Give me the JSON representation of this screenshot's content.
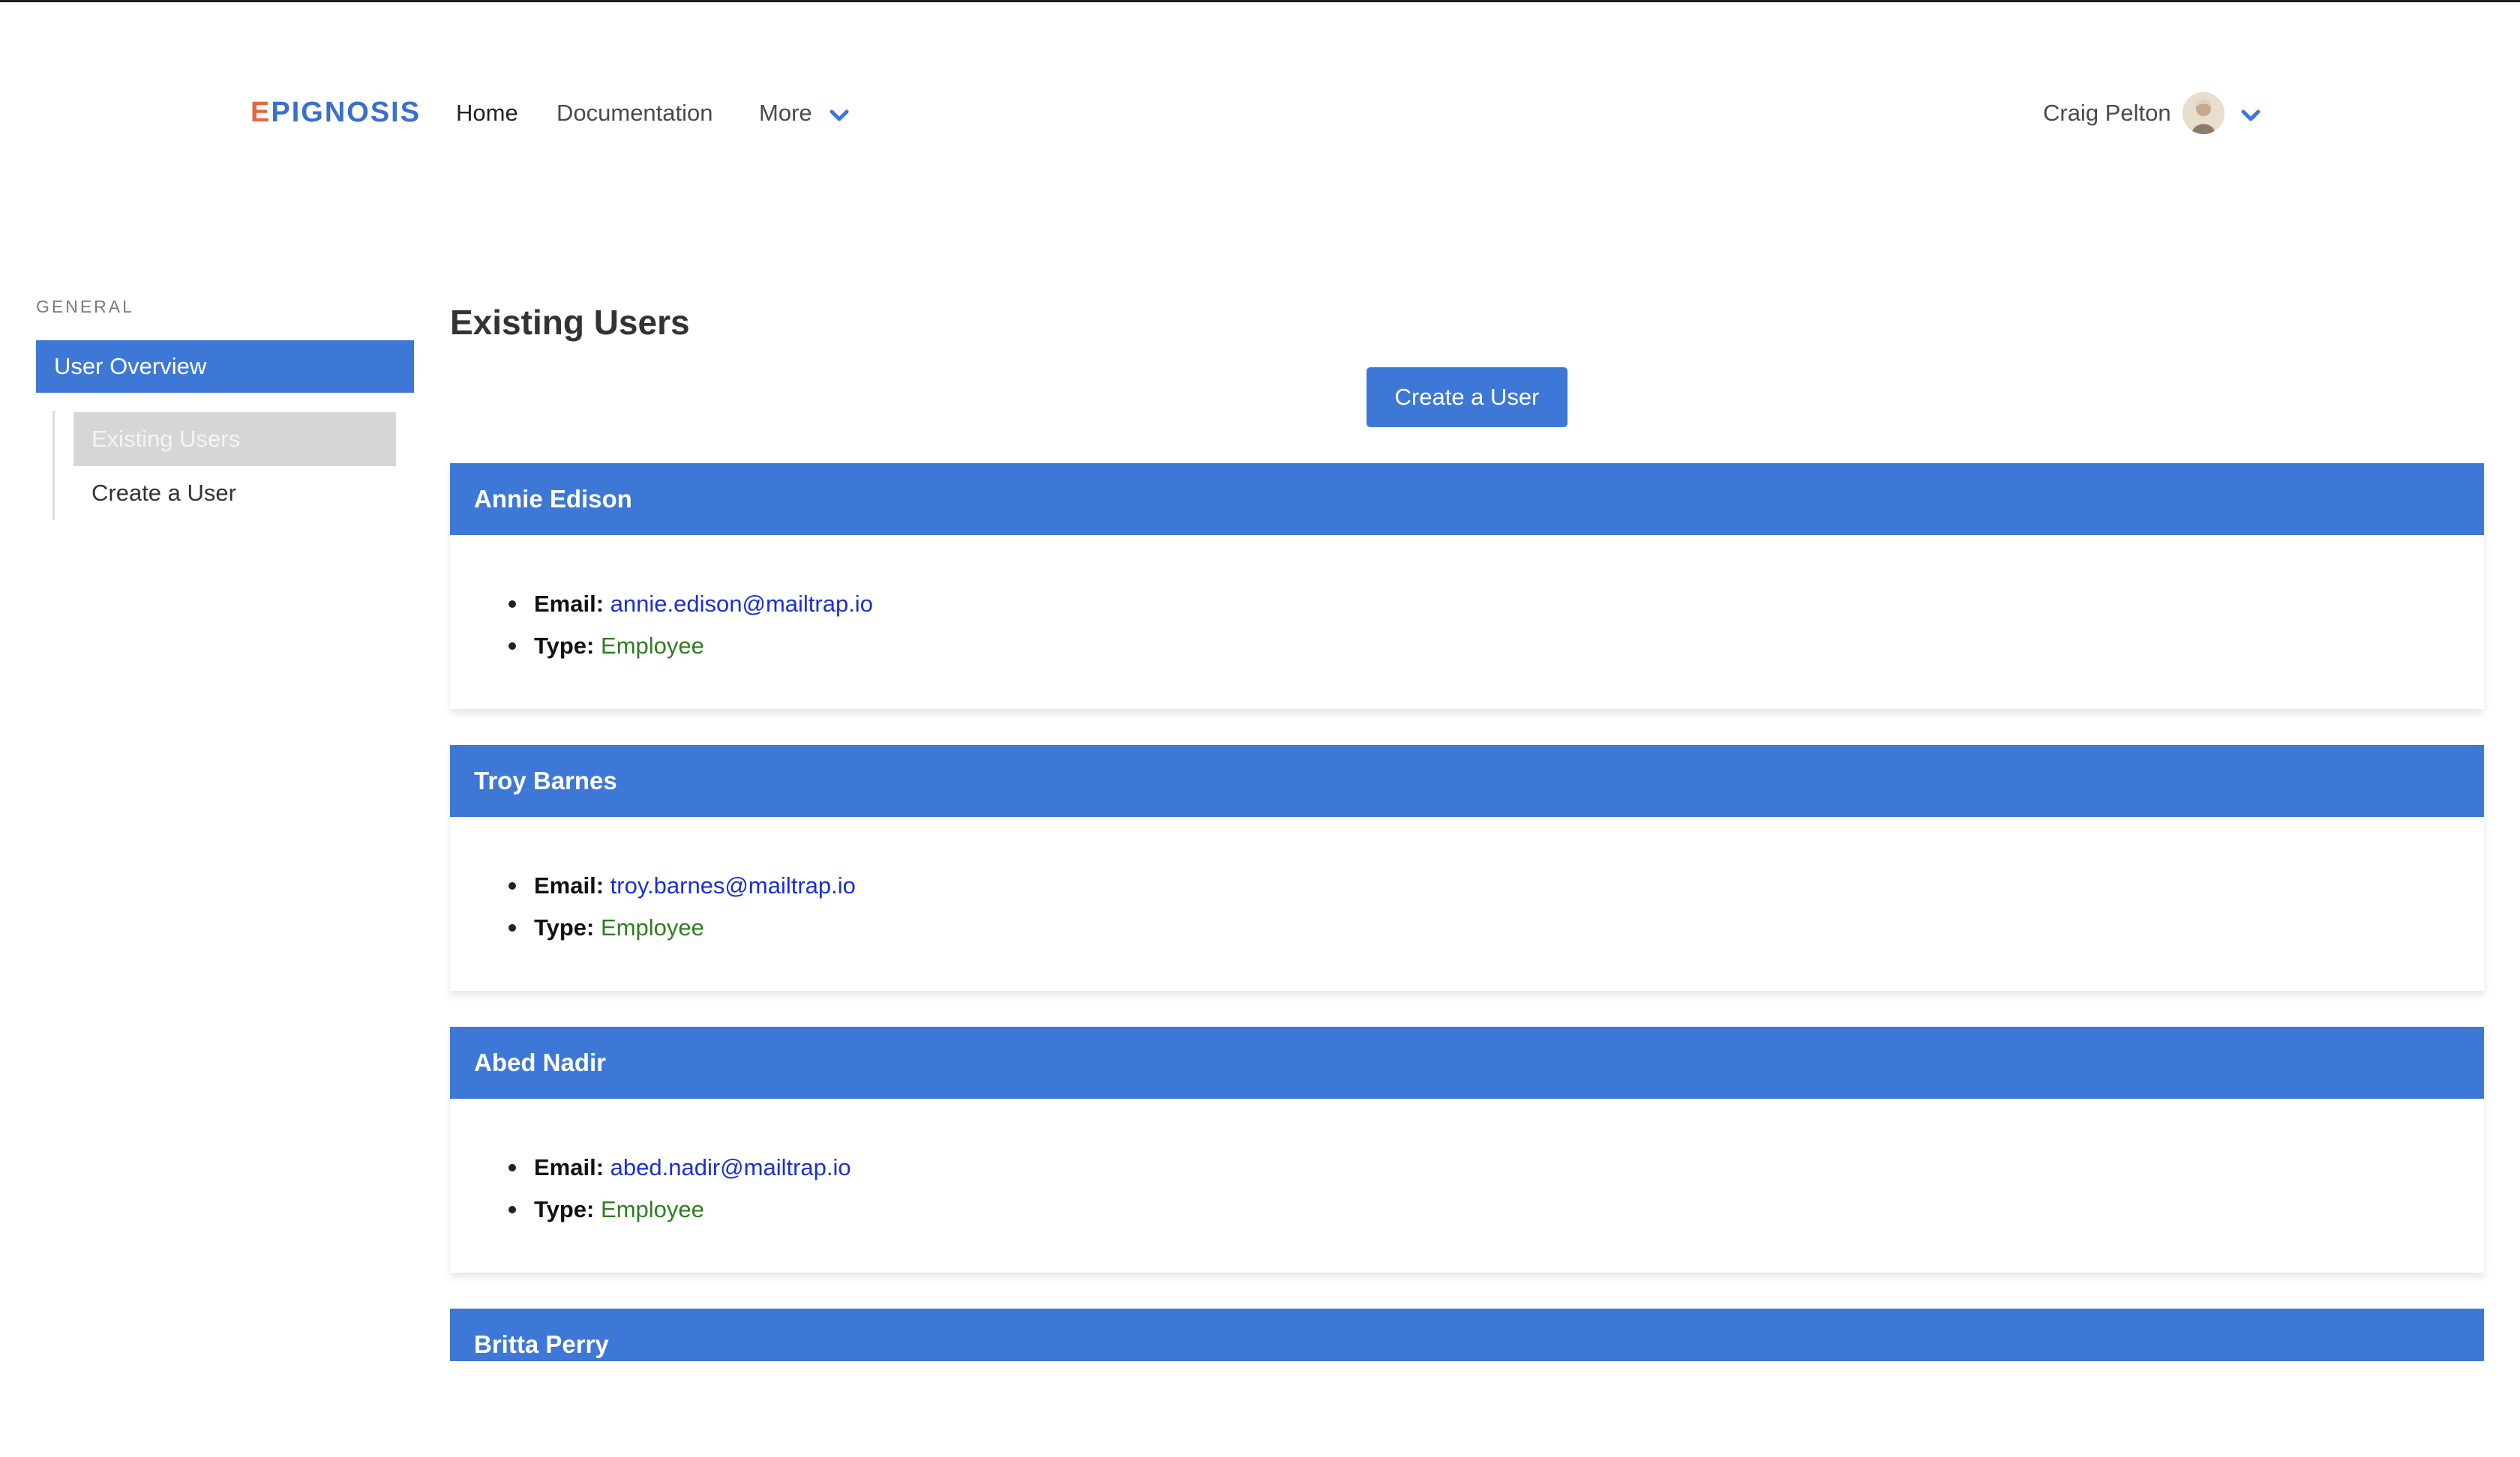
{
  "header": {
    "logo_accent": "E",
    "logo_rest": "PIGNOSIS",
    "nav": {
      "home": "Home",
      "documentation": "Documentation",
      "more": "More"
    },
    "user_name": "Craig Pelton"
  },
  "sidebar": {
    "heading": "GENERAL",
    "main_item": "User Overview",
    "sub_items": [
      {
        "label": "Existing Users"
      },
      {
        "label": "Create a User"
      }
    ]
  },
  "main": {
    "title": "Existing Users",
    "create_button": "Create a User",
    "email_key": "Email:",
    "type_key": "Type:",
    "users": [
      {
        "name": "Annie Edison",
        "email": "annie.edison@mailtrap.io",
        "type": "Employee"
      },
      {
        "name": "Troy Barnes",
        "email": "troy.barnes@mailtrap.io",
        "type": "Employee"
      },
      {
        "name": "Abed Nadir",
        "email": "abed.nadir@mailtrap.io",
        "type": "Employee"
      },
      {
        "name": "Britta Perry"
      }
    ]
  },
  "colors": {
    "primary": "#3e78d6",
    "logo_blue": "#3a70c9",
    "logo_orange": "#e8663a",
    "email_link": "#1a2fd6",
    "type_text": "#2f7d1f"
  }
}
